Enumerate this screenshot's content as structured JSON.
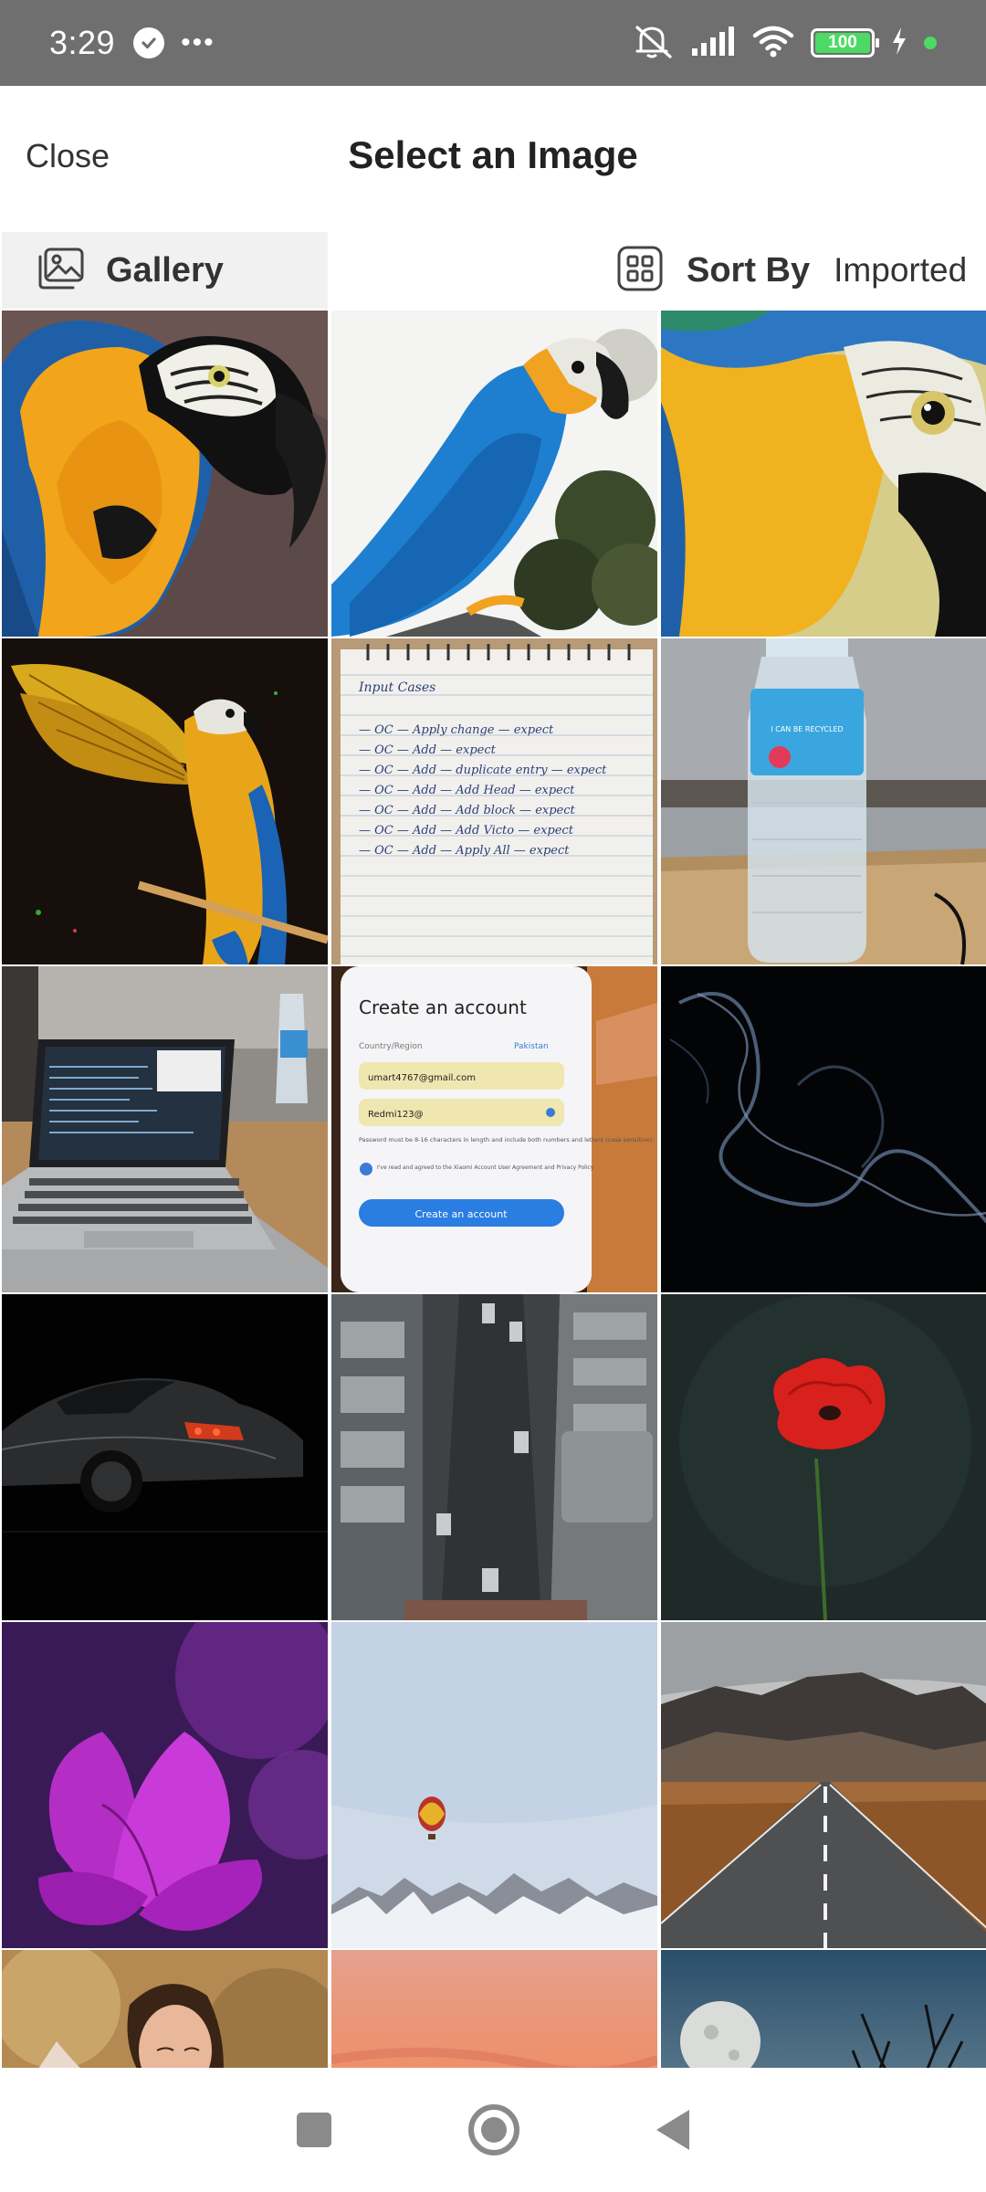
{
  "status_bar": {
    "time": "3:29",
    "more_indicator": "•••",
    "battery_level": "100",
    "icons": [
      "check-circle-icon",
      "mute-icon",
      "signal-icon",
      "wifi-icon",
      "battery-icon",
      "charging-icon"
    ]
  },
  "header": {
    "close_label": "Close",
    "title": "Select an Image"
  },
  "toolbar": {
    "gallery_label": "Gallery",
    "sort_label": "Sort By",
    "sort_value": "Imported"
  },
  "images": [
    {
      "subject": "macaw-closeup"
    },
    {
      "subject": "macaw-perched"
    },
    {
      "subject": "macaw-eye"
    },
    {
      "subject": "macaw-wings"
    },
    {
      "subject": "handwritten-notes"
    },
    {
      "subject": "water-bottle"
    },
    {
      "subject": "laptop"
    },
    {
      "subject": "phone-signup-screen"
    },
    {
      "subject": "smoke"
    },
    {
      "subject": "sports-car"
    },
    {
      "subject": "city-street"
    },
    {
      "subject": "red-poppy"
    },
    {
      "subject": "magenta-flower"
    },
    {
      "subject": "hot-air-balloon"
    },
    {
      "subject": "mountain-road"
    },
    {
      "subject": "woman-portrait"
    },
    {
      "subject": "sunset-sky"
    },
    {
      "subject": "moon-tree"
    }
  ],
  "phone_screen_text": {
    "title": "Create an account",
    "region_label": "Country/Region",
    "region_value": "Pakistan",
    "email": "umart4767@gmail.com",
    "password": "Redmi123@",
    "hint": "Password must be 8-16 characters in length and include both numbers and letters (case sensitive).",
    "agree": "I've read and agreed to the Xiaomi Account User Agreement and Privacy Policy",
    "button": "Create an account"
  },
  "notes_text": {
    "heading": "Input Cases",
    "lines": [
      "— OC — Apply change — expect",
      "— OC — Add — expect",
      "— OC — Add — duplicate entry — expect",
      "— OC — Add — Add Head — expect",
      "— OC — Add — Add block — expect",
      "— OC — Add — Add Victo — expect",
      "— OC — Add — Apply All — expect"
    ]
  },
  "bottle_label": "I CAN BE RECYCLED",
  "nav_bar": {
    "icons": [
      "recent-apps-icon",
      "home-icon",
      "back-icon"
    ]
  }
}
